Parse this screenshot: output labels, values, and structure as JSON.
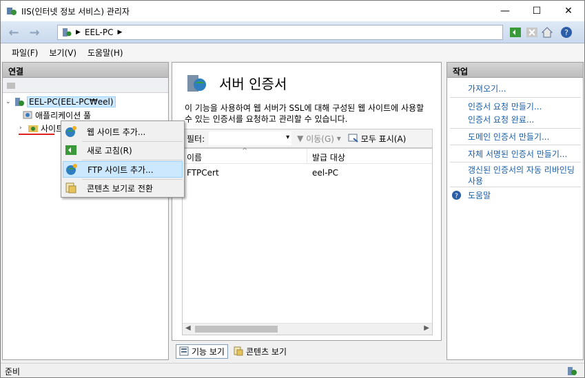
{
  "window": {
    "title": "IIS(인터넷 정보 서비스) 관리자",
    "minimize": "—",
    "maximize": "☐",
    "close": "✕"
  },
  "address": {
    "back": "←",
    "forward": "→",
    "path": [
      "EEL-PC"
    ]
  },
  "menu": [
    "파일(F)",
    "보기(V)",
    "도움말(H)"
  ],
  "connections": {
    "header": "연결",
    "tree": {
      "root": "EEL-PC(EEL-PC₩eel)",
      "app_pools": "애플리케이션 풀",
      "sites": "사이트"
    }
  },
  "context_menu": {
    "add_website": "웹 사이트 추가...",
    "refresh": "새로 고침(R)",
    "add_ftp_site": "FTP 사이트 추가...",
    "switch_content_view": "콘텐츠 보기로 전환"
  },
  "center": {
    "title": "서버 인증서",
    "description": "이 기능을 사용하여 웹 서버가 SSL에 대해 구성된 웹 사이트에 사용할 수 있는 인증서를 요청하고 관리할 수 있습니다.",
    "filter_label": "필터:",
    "filter_value": "",
    "go": "이동(G)",
    "show_all": "모두 표시(A)",
    "columns": [
      "이름",
      "발급 대상"
    ],
    "rows": [
      {
        "name": "FTPCert",
        "issued_to": "eel-PC"
      }
    ],
    "view_tabs": {
      "features": "기능 보기",
      "content": "콘텐츠 보기"
    }
  },
  "actions": {
    "header": "작업",
    "items": [
      "가져오기...",
      "인증서 요청 만들기...",
      "인증서 요청 완료...",
      "도메인 인증서 만들기...",
      "자체 서명된 인증서 만들기...",
      "갱신된 인증서의 자동 리바인딩 사용",
      "도움말"
    ]
  },
  "status": {
    "text": "준비"
  },
  "colors": {
    "link": "#1a5fa8",
    "selection": "#cce8ff",
    "annotation": "#e02020"
  }
}
